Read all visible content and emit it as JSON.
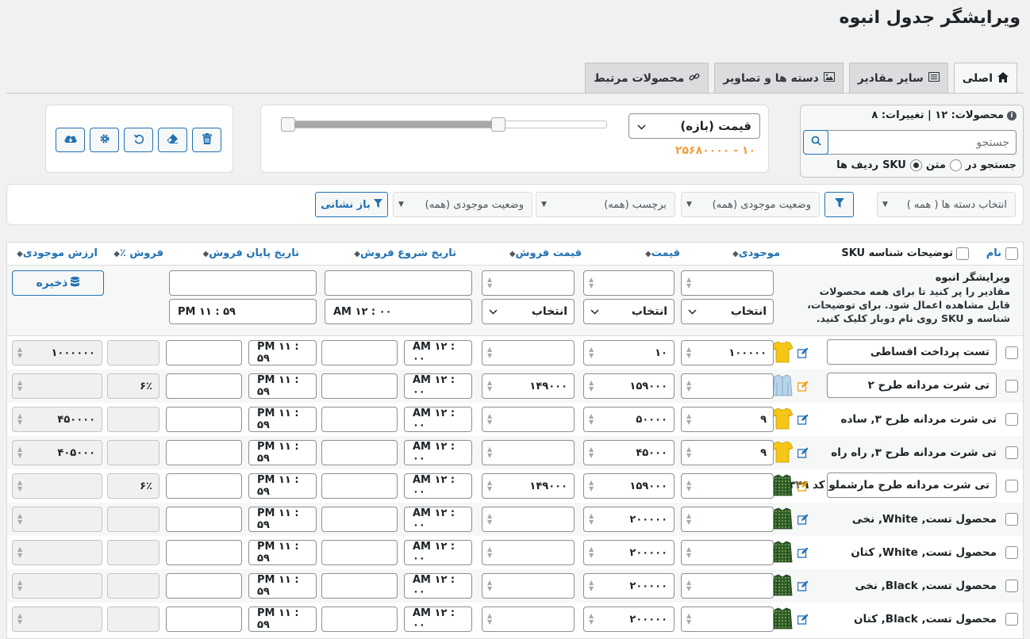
{
  "page_title": "ویرایشگر جدول انبوه",
  "tabs": [
    {
      "label": "اصلی",
      "icon": "home-icon"
    },
    {
      "label": "سایر مقادیر",
      "icon": "list-icon"
    },
    {
      "label": "دسته ها و تصاویر",
      "icon": "image-icon"
    },
    {
      "label": "محصولات مرتبط",
      "icon": "link-icon"
    }
  ],
  "search": {
    "info": "محصولات: ۱۲ | تغییرات: ۸",
    "placeholder": "جستجو",
    "search_in_label": "جستجو در",
    "opt_text": "متن",
    "opt_sku": "SKU",
    "opt_rows": "ردیف ها"
  },
  "range": {
    "select_label": "قیمت (بازه)",
    "value": "۱۰ - ۲۵۶۸۰۰۰۰",
    "low_fraction": 0.0,
    "high_fraction": 0.66
  },
  "filters": {
    "category": "انتخاب دسته ها ( همه )",
    "stock1": "وضعیت موجودی (همه)",
    "tag": "برچسب (همه)",
    "stock2": "وضعیت موجودی (همه)",
    "reset": "باز نشانی"
  },
  "columns": {
    "name": "نام",
    "desc_sku": "توضیحات شناسه SKU",
    "stock": "موجودی",
    "price": "قیمت",
    "sale_price": "قیمت فروش",
    "sale_start": "تاریخ شروع فروش",
    "sale_end": "تاریخ پایان فروش",
    "sale_pct": "فروش ٪",
    "stock_value": "ارزش موجودی"
  },
  "bulk": {
    "title": "ویرایشگر انبوه",
    "desc": "مقادیر را پر کنید تا برای همه محصولات قابل مشاهده اعمال شود. برای توضیحات، شناسه و SKU روی نام دوبار کلیک کنید.",
    "select": "انتخاب",
    "start_time": "AM  ۱۲ : ۰۰",
    "end_time": "PM  ۱۱ : ۵۹",
    "save": "ذخیره"
  },
  "rows": [
    {
      "name": "تست پرداخت اقساطی",
      "boxed": true,
      "shirt": "yellow",
      "stock": "۱۰۰۰۰۰",
      "price": "۱۰",
      "sale": "",
      "start": "AM  ۱۲ : ۰۰",
      "end": "PM  ۱۱ : ۵۹",
      "pct": "",
      "value": "۱۰۰۰۰۰۰"
    },
    {
      "name": "تی شرت مردانه طرح ۲",
      "boxed": true,
      "shirt": "blue",
      "stock": "",
      "price": "۱۵۹۰۰۰",
      "sale": "۱۴۹۰۰۰",
      "start": "AM  ۱۲ : ۰۰",
      "end": "PM  ۱۱ : ۵۹",
      "pct": "۶٪",
      "value": ""
    },
    {
      "name": "تی شرت مردانه طرح ۳, ساده",
      "boxed": false,
      "shirt": "yellow",
      "stock": "۹",
      "price": "۵۰۰۰۰",
      "sale": "",
      "start": "AM  ۱۲ : ۰۰",
      "end": "PM  ۱۱ : ۵۹",
      "pct": "",
      "value": "۴۵۰۰۰۰"
    },
    {
      "name": "تی شرت مردانه طرح ۳, راه راه",
      "boxed": false,
      "shirt": "yellow",
      "stock": "۹",
      "price": "۴۵۰۰۰",
      "sale": "",
      "start": "AM  ۱۲ : ۰۰",
      "end": "PM  ۱۱ : ۵۹",
      "pct": "",
      "value": "۴۰۵۰۰۰"
    },
    {
      "name": "تی شرت مردانه طرح مارشملو کد ۳۴۹",
      "boxed": true,
      "shirt": "green",
      "stock": "",
      "price": "۱۵۹۰۰۰",
      "sale": "۱۴۹۰۰۰",
      "start": "AM  ۱۲ : ۰۰",
      "end": "PM  ۱۱ : ۵۹",
      "pct": "۶٪",
      "value": ""
    },
    {
      "name": "محصول تست, White, نخی",
      "boxed": false,
      "shirt": "green",
      "stock": "",
      "price": "۲۰۰۰۰۰",
      "sale": "",
      "start": "AM  ۱۲ : ۰۰",
      "end": "PM  ۱۱ : ۵۹",
      "pct": "",
      "value": ""
    },
    {
      "name": "محصول تست, White, کتان",
      "boxed": false,
      "shirt": "green",
      "stock": "",
      "price": "۲۰۰۰۰۰",
      "sale": "",
      "start": "AM  ۱۲ : ۰۰",
      "end": "PM  ۱۱ : ۵۹",
      "pct": "",
      "value": ""
    },
    {
      "name": "محصول تست, Black, نخی",
      "boxed": false,
      "shirt": "green",
      "stock": "",
      "price": "۲۰۰۰۰۰",
      "sale": "",
      "start": "AM  ۱۲ : ۰۰",
      "end": "PM  ۱۱ : ۵۹",
      "pct": "",
      "value": ""
    },
    {
      "name": "محصول تست, Black, کتان",
      "boxed": false,
      "shirt": "green",
      "stock": "",
      "price": "۲۰۰۰۰۰",
      "sale": "",
      "start": "AM  ۱۲ : ۰۰",
      "end": "PM  ۱۱ : ۵۹",
      "pct": "",
      "value": ""
    }
  ],
  "colors": {
    "accent": "#2271b1",
    "range_value": "#f0a040",
    "edit_blue": "#2271b1",
    "edit_orange": "#f0a000"
  }
}
